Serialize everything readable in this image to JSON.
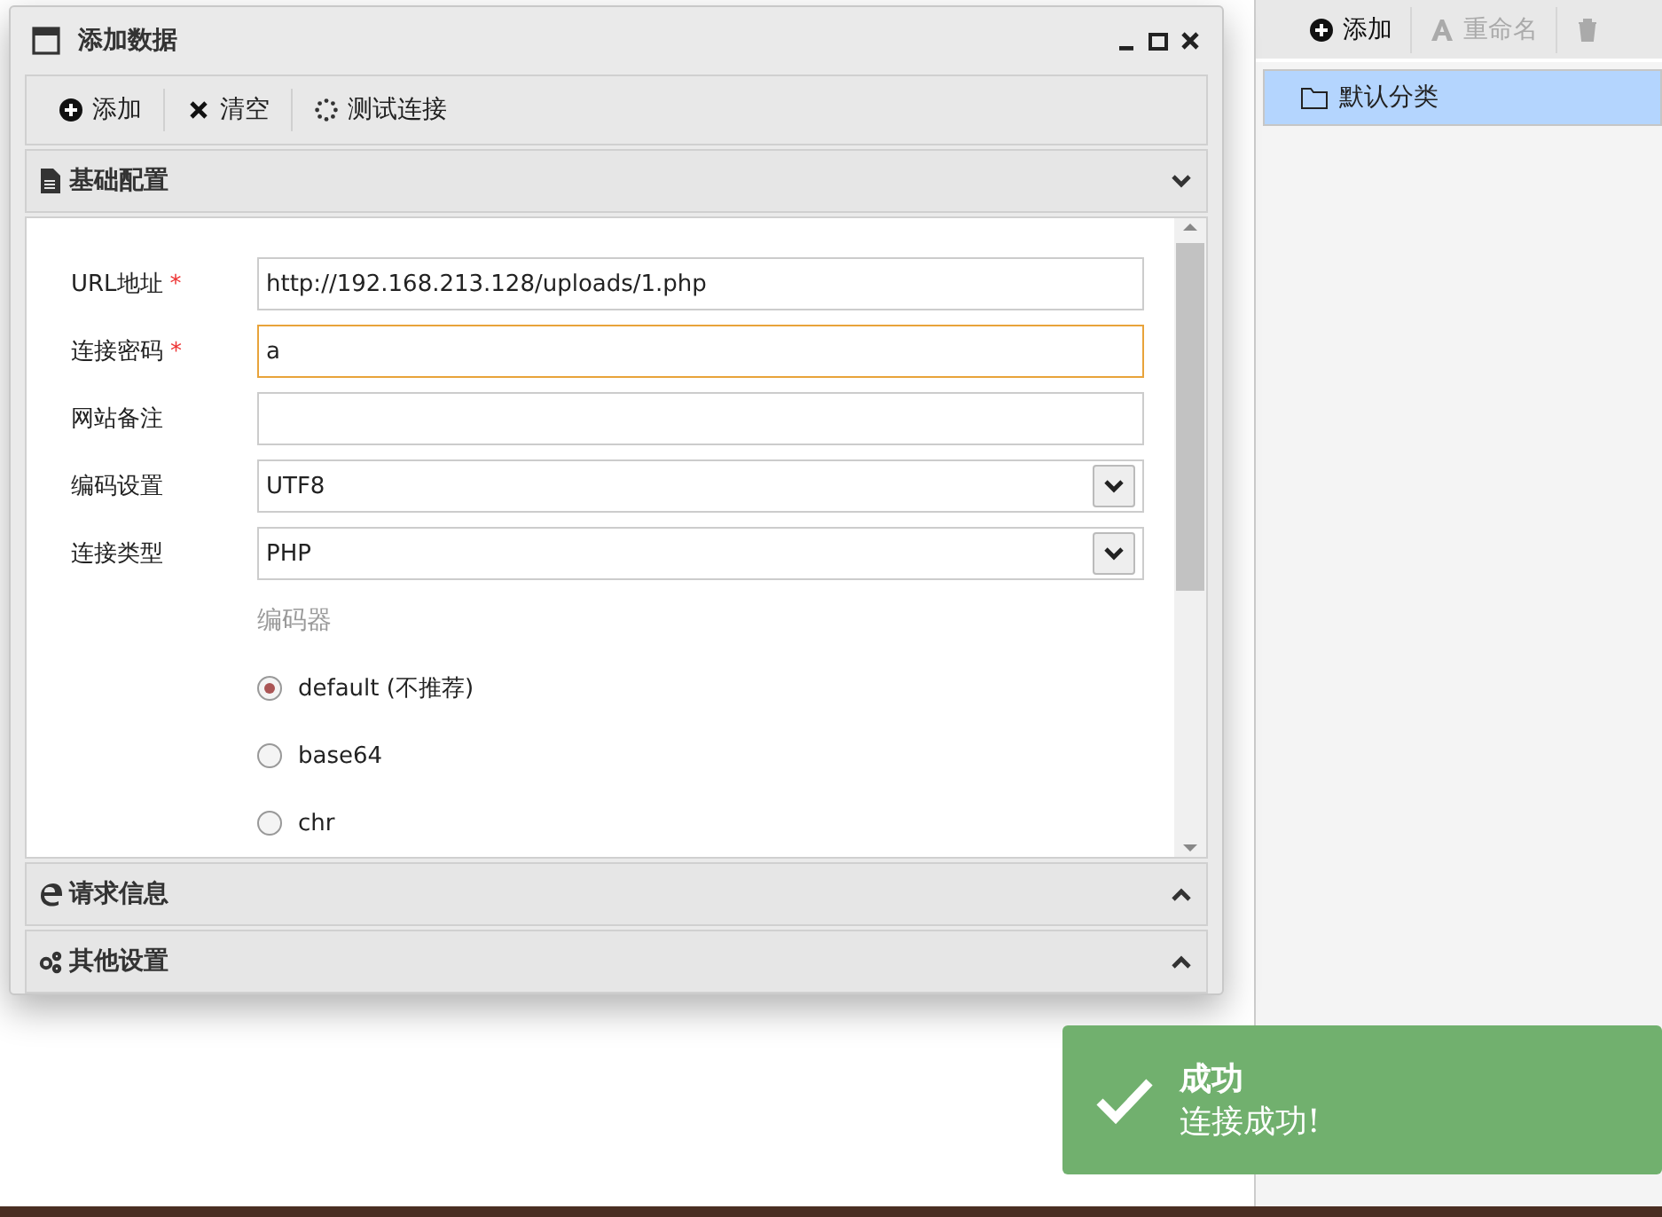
{
  "window": {
    "title": "添加数据"
  },
  "toolbar": [
    {
      "label": "添加"
    },
    {
      "label": "清空"
    },
    {
      "label": "测试连接"
    }
  ],
  "sections": [
    {
      "title": "基础配置",
      "expanded": true
    },
    {
      "title": "请求信息",
      "expanded": false
    },
    {
      "title": "其他设置",
      "expanded": false
    }
  ],
  "form": {
    "fields": [
      {
        "label": "URL地址",
        "required_mark": "*",
        "kind": "text",
        "value": "http://192.168.213.128/uploads/1.php",
        "focused": false
      },
      {
        "label": "连接密码",
        "required_mark": "*",
        "kind": "text",
        "value": "a",
        "focused": true
      },
      {
        "label": "网站备注",
        "kind": "text",
        "focused": false
      },
      {
        "label": "编码设置",
        "kind": "select",
        "value": "UTF8",
        "focused": false
      },
      {
        "label": "连接类型",
        "kind": "select",
        "value": "PHP",
        "focused": false
      }
    ],
    "encoder": {
      "label": "编码器",
      "options": [
        {
          "label": "default (不推荐)",
          "selected": true
        },
        {
          "label": "base64",
          "selected": false
        },
        {
          "label": "chr",
          "selected": false
        }
      ]
    }
  },
  "side_toolbar": [
    {
      "label": "添加",
      "disabled": false
    },
    {
      "label": "重命名",
      "disabled": true
    },
    {
      "disabled": true
    }
  ],
  "categories": [
    {
      "label": "默认分类",
      "selected": true
    }
  ],
  "toast": {
    "title": "成功",
    "message": "连接成功!"
  }
}
